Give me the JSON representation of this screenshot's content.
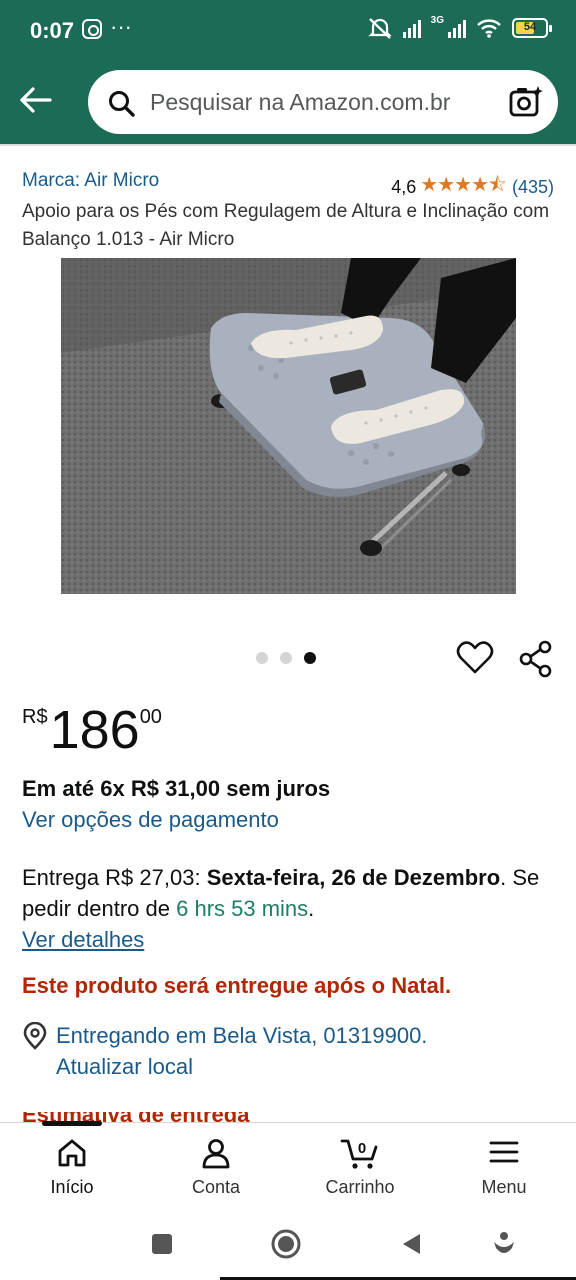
{
  "status_bar": {
    "time": "0:07",
    "more": "···",
    "network": "3G",
    "battery": "54"
  },
  "search": {
    "placeholder": "Pesquisar na Amazon.com.br"
  },
  "product": {
    "brand": "Marca: Air Micro",
    "rating_value": "4,6",
    "rating_stars": "★★★★⯪",
    "rating_count": "(435)",
    "title": "Apoio para os Pés com Regulagem de Altura e Inclinação com Balanço 1.013 - Air Micro",
    "carousel_index": 3,
    "carousel_total": 3
  },
  "price": {
    "currency": "R$",
    "whole": "186",
    "cents": "00"
  },
  "installments": "Em até 6x R$ 31,00 sem juros",
  "payment_link": "Ver opções de pagamento",
  "delivery": {
    "prefix": "Entrega R$ 27,03: ",
    "date": "Sexta-feira, 26 de Dezembro",
    "middle": ". Se pedir dentro de ",
    "countdown": "6 hrs 53 mins",
    "suffix": ".",
    "details_link": "Ver detalhes"
  },
  "notice": "Este produto será entregue após o Natal.",
  "location": {
    "line1": "Entregando em Bela Vista, 01319900.",
    "line2": "Atualizar local"
  },
  "peek_text": "Estimativa de entrega",
  "bottom_nav": [
    {
      "label": "Início",
      "icon": "home-icon"
    },
    {
      "label": "Conta",
      "icon": "account-icon"
    },
    {
      "label": "Carrinho",
      "icon": "cart-icon",
      "badge": "0"
    },
    {
      "label": "Menu",
      "icon": "menu-icon"
    }
  ],
  "colors": {
    "header": "#1c6b57",
    "link": "#1a5a8a",
    "star": "#de7921",
    "alert": "#b12704",
    "green": "#1c7e66"
  }
}
